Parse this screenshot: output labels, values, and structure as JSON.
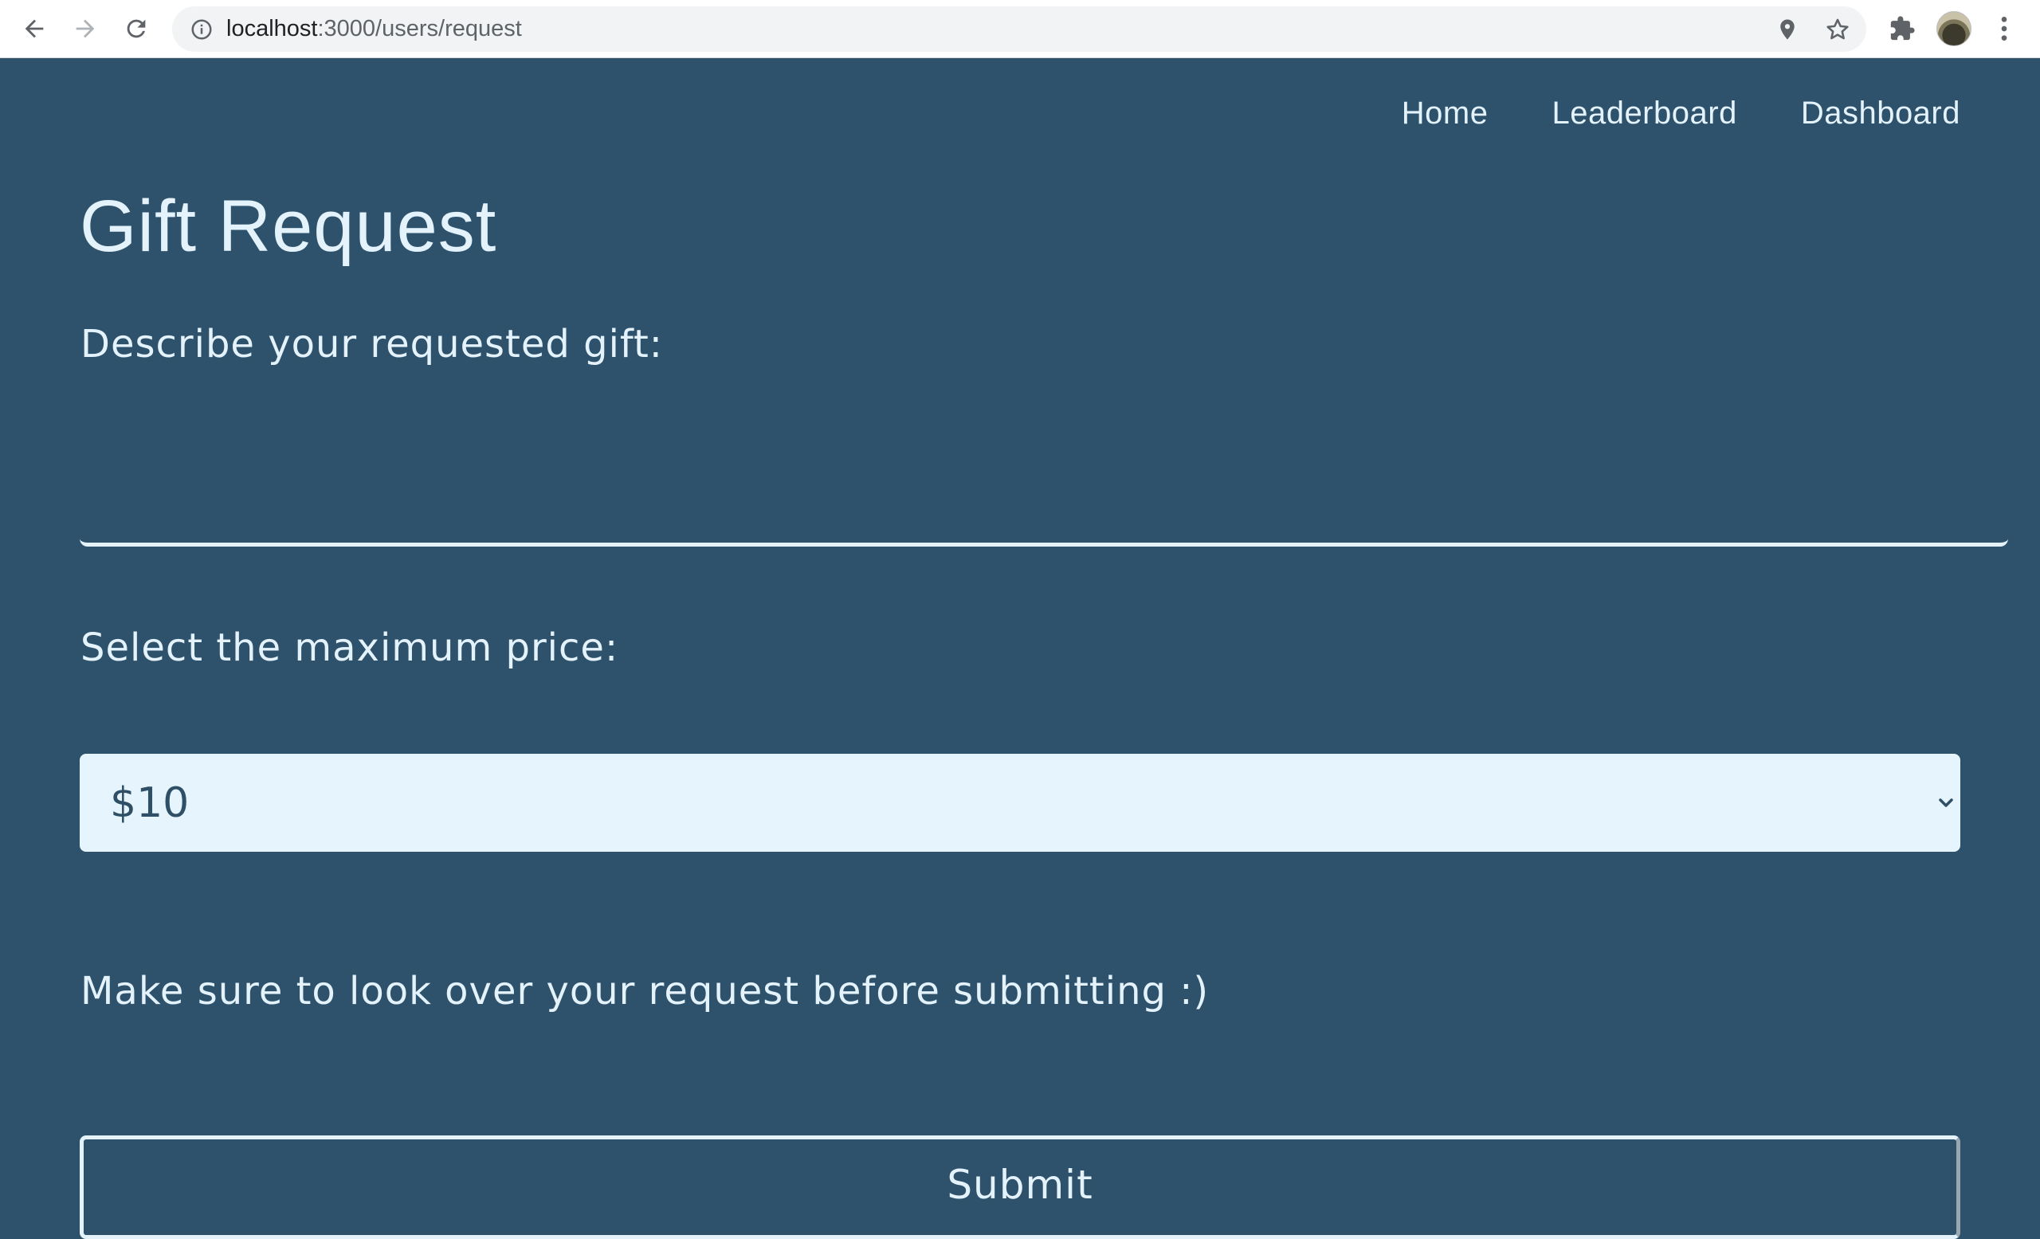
{
  "browser": {
    "url_host": "localhost",
    "url_path": ":3000/users/request",
    "icons": {
      "back": "arrow-left-icon",
      "forward": "arrow-right-icon",
      "reload": "reload-icon",
      "site_info": "info-icon",
      "location": "location-pin-icon",
      "bookmark": "star-icon",
      "extensions": "puzzle-icon",
      "profile": "avatar",
      "menu": "kebab-menu-icon"
    }
  },
  "nav": {
    "items": [
      {
        "label": "Home"
      },
      {
        "label": "Leaderboard"
      },
      {
        "label": "Dashboard"
      }
    ]
  },
  "page": {
    "title": "Gift Request",
    "describe_label": "Describe your requested gift:",
    "gift_description_value": "",
    "price_label": "Select the maximum price:",
    "price_selected": "$10",
    "note": "Make sure to look over your request before submitting :)",
    "submit_label": "Submit"
  },
  "colors": {
    "background": "#2e526b",
    "text": "#e3f2fb",
    "select_background": "#e6f5fd",
    "select_text": "#2e4f66"
  }
}
